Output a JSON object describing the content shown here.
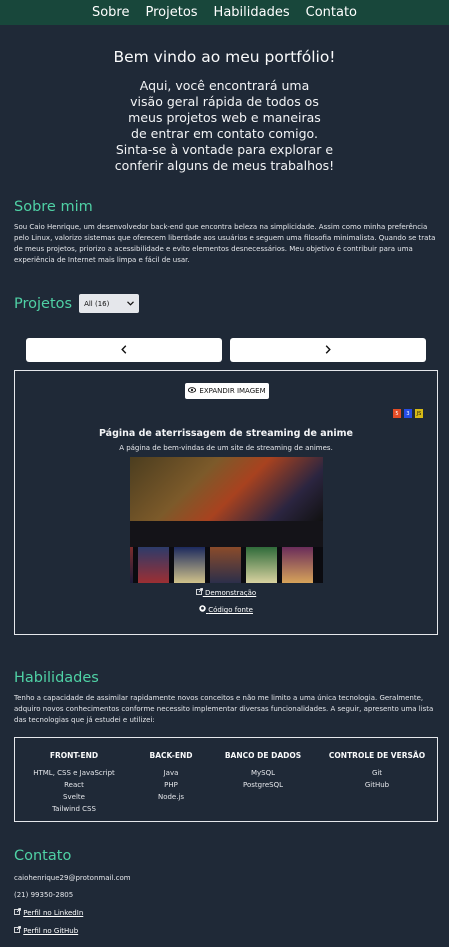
{
  "nav": {
    "items": [
      "Sobre",
      "Projetos",
      "Habilidades",
      "Contato"
    ]
  },
  "hero": {
    "title": "Bem vindo ao meu portfólio!",
    "intro": "Aqui, você encontrará uma visão geral rápida de todos os meus projetos web e maneiras de entrar em contato comigo.",
    "invite": "Sinta-se à vontade para explorar e conferir alguns de meus trabalhos!"
  },
  "about": {
    "title": "Sobre mim",
    "text": "Sou Caio Henrique, um desenvolvedor back-end que encontra beleza na simplicidade. Assim como minha preferência pelo Linux, valorizo sistemas que oferecem liberdade aos usuários e seguem uma filosofia minimalista. Quando se trata de meus projetos, priorizo a acessibilidade e evito elementos desnecessários. Meu objetivo é contribuir para uma experiência de Internet mais limpa e fácil de usar."
  },
  "projects": {
    "title": "Projetos",
    "filter_value": "All (16)",
    "prev_icon": "chevron-left-icon",
    "next_icon": "chevron-right-icon",
    "expand_label": "EXPANDIR IMAGEM",
    "tech_icons": [
      "html5-icon",
      "css3-icon",
      "js-icon"
    ],
    "current": {
      "title": "Página de aterrissagem de streaming de anime",
      "description": "A página de bem-vindas de um site de streaming de animes.",
      "demo_label": "Demonstração",
      "source_label": "Código fonte"
    }
  },
  "skills": {
    "title": "Habilidades",
    "text": "Tenho a capacidade de assimilar rapidamente novos conceitos e não me limito a uma única tecnologia. Geralmente, adquiro novos conhecimentos conforme necessito implementar diversas funcionalidades. A seguir, apresento uma lista das tecnologias que já estudei e utilizei:",
    "groups": [
      {
        "name": "FRONT-END",
        "items": [
          "HTML, CSS e JavaScript",
          "React",
          "Svelte",
          "Tailwind CSS"
        ]
      },
      {
        "name": "BACK-END",
        "items": [
          "Java",
          "PHP",
          "Node.js"
        ]
      },
      {
        "name": "BANCO DE DADOS",
        "items": [
          "MySQL",
          "PostgreSQL"
        ]
      },
      {
        "name": "CONTROLE DE VERSÃO",
        "items": [
          "Git",
          "GitHub"
        ]
      }
    ]
  },
  "contact": {
    "title": "Contato",
    "email": "caiohenrique29@protonmail.com",
    "phone": "(21) 99350-2805",
    "linkedin_label": "Perfil no LinkedIn",
    "github_label": "Perfil no GitHub"
  },
  "colors": {
    "accent": "#4fd1a5",
    "nav_bg": "#18473b",
    "page_bg": "#1f2937"
  }
}
